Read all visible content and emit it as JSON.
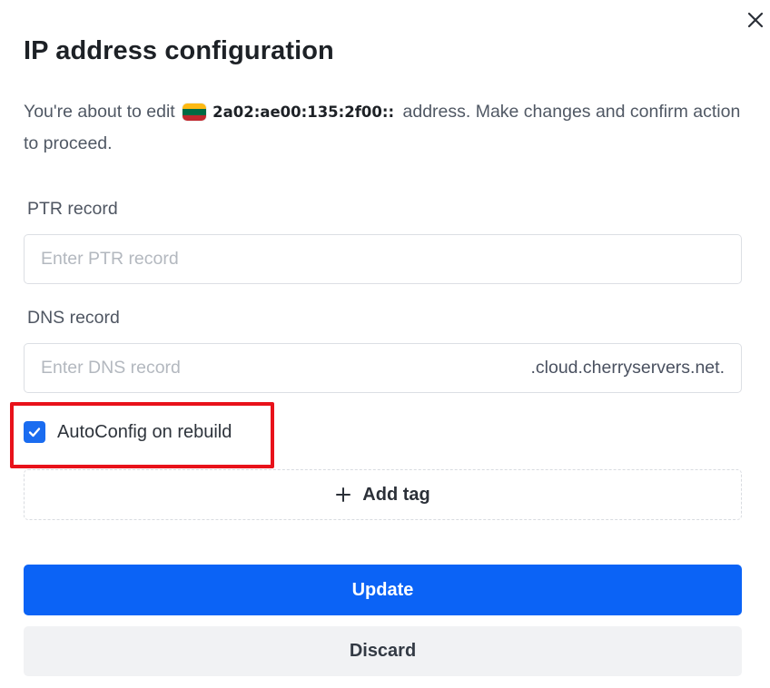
{
  "dialog": {
    "title": "IP address configuration",
    "description_prefix": "You're about to edit",
    "ip_address": "2a02:ae00:135:2f00::",
    "description_suffix": "address. Make changes and confirm action to proceed.",
    "flag_icon": "lithuania-flag-icon",
    "flag_colors": [
      "#fdb913",
      "#006a44",
      "#c1272d"
    ]
  },
  "close": {
    "icon": "close-icon"
  },
  "ptr": {
    "label": "PTR record",
    "placeholder": "Enter PTR record",
    "value": ""
  },
  "dns": {
    "label": "DNS record",
    "placeholder": "Enter DNS record",
    "value": "",
    "suffix": ".cloud.cherryservers.net."
  },
  "autoconfig": {
    "label": "AutoConfig on rebuild",
    "checked": true
  },
  "tags": {
    "add_label": "Add tag",
    "icon": "plus-icon"
  },
  "actions": {
    "update_label": "Update",
    "discard_label": "Discard"
  },
  "colors": {
    "primary": "#0b63f6",
    "highlight": "#e8121a",
    "secondary_bg": "#f1f2f4"
  }
}
